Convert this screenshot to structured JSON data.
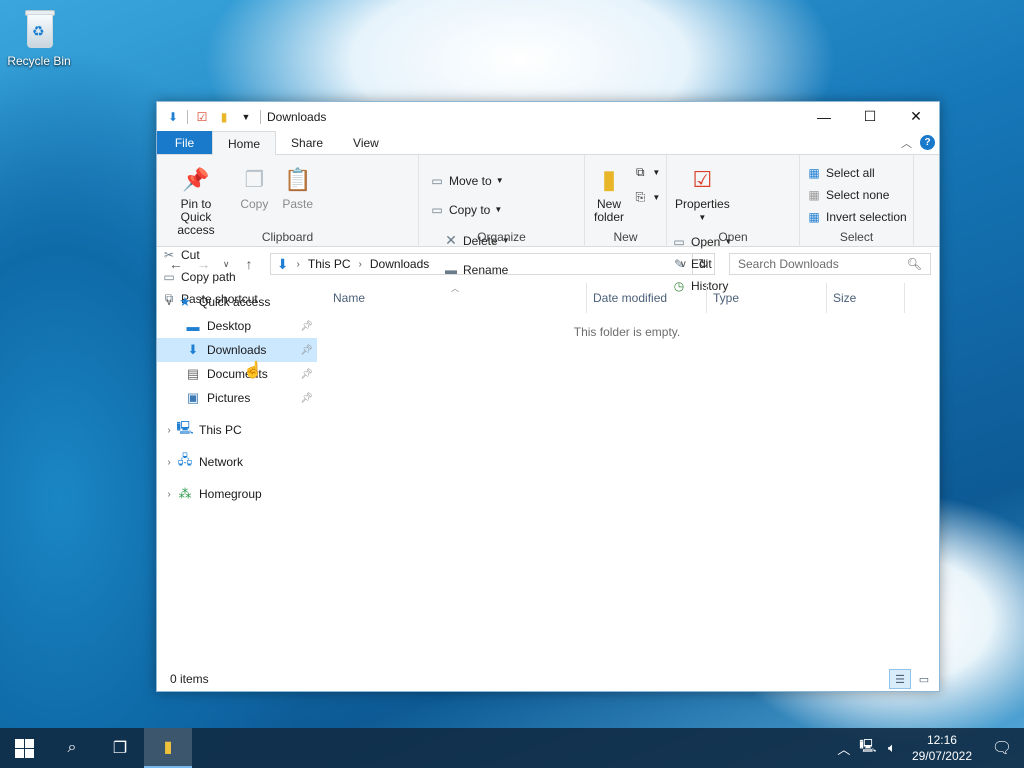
{
  "desktop": {
    "recycle_bin_label": "Recycle Bin"
  },
  "window": {
    "title": "Downloads",
    "controls": {
      "minimize": "—",
      "maximize": "☐",
      "close": "✕"
    }
  },
  "tabs": {
    "file": "File",
    "home": "Home",
    "share": "Share",
    "view": "View"
  },
  "ribbon": {
    "clipboard": {
      "label": "Clipboard",
      "pin": "Pin to Quick access",
      "copy": "Copy",
      "paste": "Paste",
      "cut": "Cut",
      "copy_path": "Copy path",
      "paste_shortcut": "Paste shortcut"
    },
    "organize": {
      "label": "Organize",
      "move_to": "Move to",
      "copy_to": "Copy to",
      "delete": "Delete",
      "rename": "Rename"
    },
    "new": {
      "label": "New",
      "new_folder": "New folder"
    },
    "open": {
      "label": "Open",
      "properties": "Properties",
      "open": "Open",
      "edit": "Edit",
      "history": "History"
    },
    "select": {
      "label": "Select",
      "select_all": "Select all",
      "select_none": "Select none",
      "invert": "Invert selection"
    }
  },
  "address": {
    "path": [
      "This PC",
      "Downloads"
    ],
    "search_placeholder": "Search Downloads"
  },
  "nav": {
    "quick_access": "Quick access",
    "desktop": "Desktop",
    "downloads": "Downloads",
    "documents": "Documents",
    "pictures": "Pictures",
    "this_pc": "This PC",
    "network": "Network",
    "homegroup": "Homegroup"
  },
  "columns": {
    "name": "Name",
    "date_modified": "Date modified",
    "type": "Type",
    "size": "Size"
  },
  "empty_message": "This folder is empty.",
  "status": {
    "items": "0 items"
  },
  "taskbar": {
    "time": "12:16",
    "date": "29/07/2022"
  },
  "icons": {
    "nav_back": "arrow-left-icon",
    "nav_forward": "arrow-right-icon",
    "nav_up": "arrow-up-icon",
    "refresh": "refresh-icon",
    "search": "search-icon"
  }
}
